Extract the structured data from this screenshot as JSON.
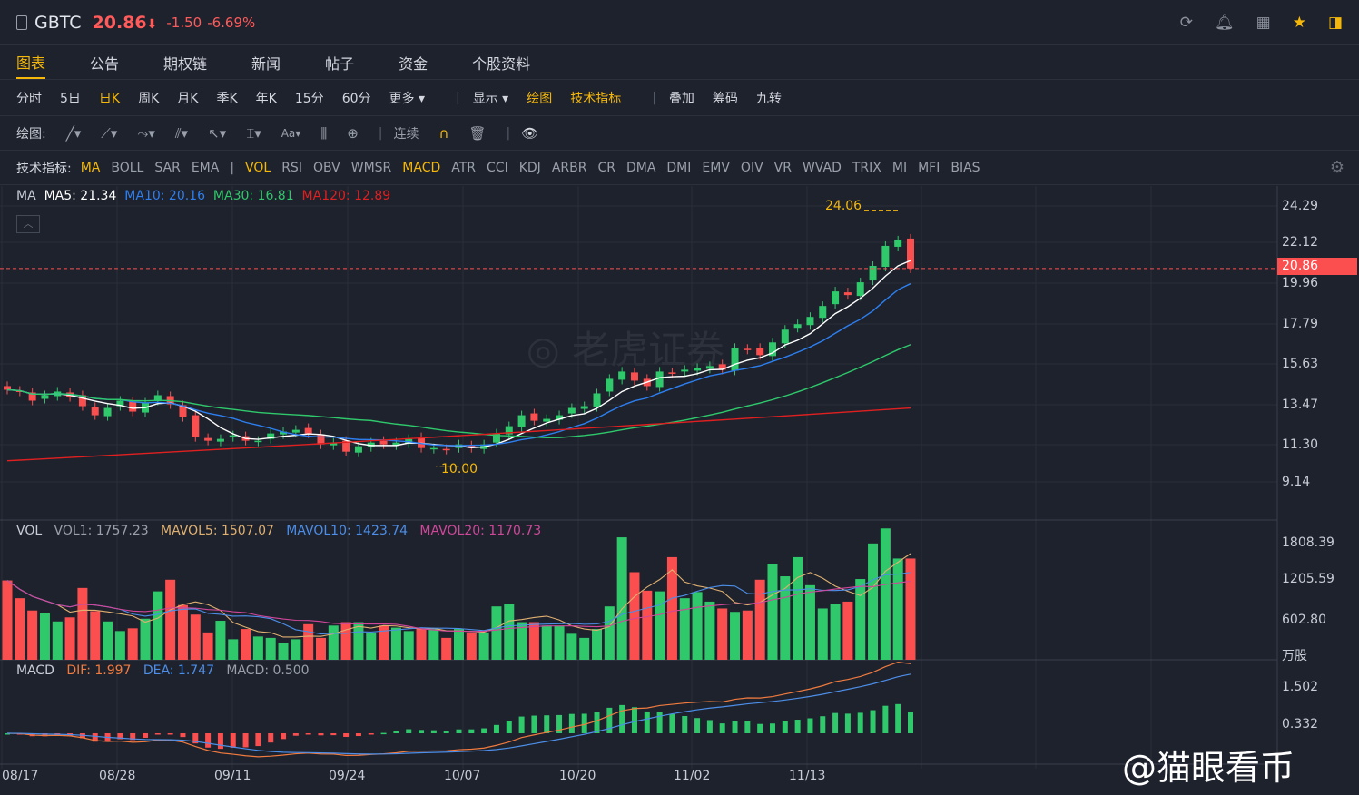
{
  "header": {
    "symbol": "GBTC",
    "price": "20.86",
    "arrow": "⬇",
    "change": "-1.50",
    "change_pct": "-6.69%"
  },
  "tabs": [
    "图表",
    "公告",
    "期权链",
    "新闻",
    "帖子",
    "资金",
    "个股资料"
  ],
  "periods": [
    "分时",
    "5日",
    "日K",
    "周K",
    "月K",
    "季K",
    "年K",
    "15分",
    "60分",
    "更多 ▾"
  ],
  "period_right": {
    "display": "显示 ▾",
    "draw": "绘图",
    "tech": "技术指标",
    "overlay": "叠加",
    "chips": "筹码",
    "nine": "九转"
  },
  "drawbar": {
    "label": "绘图:",
    "continuous": "连续"
  },
  "indicators": {
    "label": "技术指标:",
    "main": [
      "MA",
      "BOLL",
      "SAR",
      "EMA"
    ],
    "sub": [
      "VOL",
      "RSI",
      "OBV",
      "WMSR",
      "MACD",
      "ATR",
      "CCI",
      "KDJ",
      "ARBR",
      "CR",
      "DMA",
      "DMI",
      "EMV",
      "OIV",
      "VR",
      "WVAD",
      "TRIX",
      "MI",
      "MFI",
      "BIAS"
    ]
  },
  "ma": {
    "title": "MA",
    "ma5": "MA5: 21.34",
    "ma10": "MA10: 20.16",
    "ma30": "MA30: 16.81",
    "ma120": "MA120: 12.89"
  },
  "vol": {
    "title": "VOL",
    "v1": "VOL1: 1757.23",
    "v5": "MAVOL5: 1507.07",
    "v10": "MAVOL10: 1423.74",
    "v20": "MAVOL20: 1170.73"
  },
  "macd": {
    "title": "MACD",
    "dif": "DIF: 1.997",
    "dea": "DEA: 1.747",
    "macd": "MACD: 0.500"
  },
  "price_axis": [
    "24.29",
    "22.12",
    "19.96",
    "17.79",
    "15.63",
    "13.47",
    "11.30",
    "9.14"
  ],
  "price_tag": "20.86",
  "high_label": "24.06",
  "low_label": "10.00",
  "vol_axis": [
    "1808.39",
    "1205.59",
    "602.80",
    "万股"
  ],
  "macd_axis": [
    "1.502",
    "0.332"
  ],
  "dates": [
    "08/17",
    "08/28",
    "09/11",
    "09/24",
    "10/07",
    "10/20",
    "11/02",
    "11/13"
  ],
  "watermark": "@猫眼看币",
  "colors": {
    "up": "#2fc96b",
    "down": "#fb4f4f",
    "ma5": "#ffffff",
    "ma10": "#2d7ff0",
    "ma30": "#2fc96b",
    "ma120": "#e02020",
    "accent": "#f5b80a"
  },
  "chart_data": {
    "type": "candlestick",
    "closes": [
      14.2,
      14.1,
      13.6,
      13.9,
      14.1,
      13.8,
      13.3,
      12.8,
      13.2,
      13.6,
      13.0,
      13.5,
      13.9,
      13.4,
      12.7,
      11.6,
      11.4,
      11.5,
      11.7,
      11.4,
      11.4,
      11.8,
      11.9,
      12.0,
      11.8,
      11.2,
      11.3,
      10.8,
      11.1,
      11.3,
      11.2,
      11.3,
      11.5,
      11.0,
      11.0,
      10.9,
      11.2,
      11.0,
      11.2,
      11.8,
      12.2,
      12.8,
      12.5,
      12.6,
      12.8,
      13.2,
      13.3,
      14.0,
      14.8,
      15.2,
      14.7,
      14.4,
      15.2,
      15.1,
      15.3,
      15.4,
      15.5,
      15.3,
      16.5,
      16.4,
      16.1,
      16.8,
      17.5,
      17.8,
      18.2,
      18.8,
      19.6,
      19.4,
      20.1,
      21.0,
      22.1,
      22.4,
      20.86
    ],
    "volumes": [
      1160,
      900,
      720,
      680,
      560,
      620,
      1050,
      710,
      560,
      420,
      460,
      600,
      1000,
      1170,
      800,
      660,
      400,
      570,
      300,
      450,
      340,
      320,
      250,
      300,
      520,
      320,
      500,
      550,
      550,
      400,
      500,
      470,
      420,
      460,
      450,
      320,
      450,
      400,
      400,
      780,
      810,
      550,
      550,
      500,
      500,
      380,
      320,
      450,
      780,
      1790,
      1280,
      1010,
      1000,
      1500,
      900,
      990,
      850,
      750,
      700,
      720,
      1170,
      1400,
      1220,
      1500,
      1090,
      750,
      820,
      850,
      1180,
      1700,
      1920,
      1480,
      1480,
      1620,
      1850,
      1830
    ],
    "ylim": [
      9.14,
      24.29
    ],
    "annotations": {
      "high": 24.06,
      "low": 10.0,
      "last": 20.86
    }
  }
}
